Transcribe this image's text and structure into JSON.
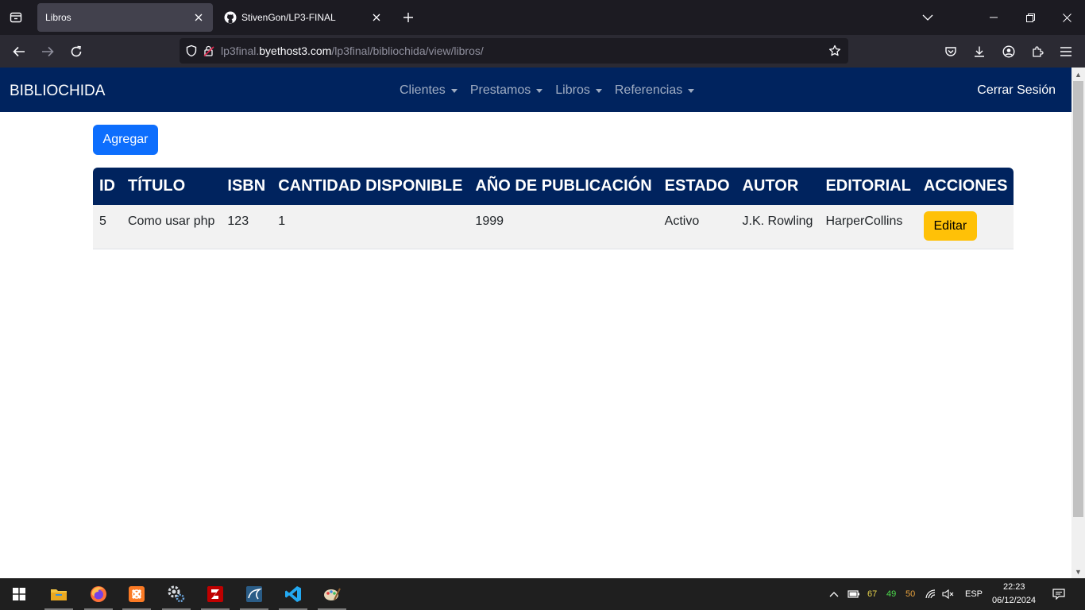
{
  "browser": {
    "tabs": [
      {
        "title": "Libros",
        "active": true
      },
      {
        "title": "StivenGon/LP3-FINAL",
        "active": false
      }
    ],
    "url": {
      "prefix": "lp3final.",
      "domain": "byethost3.com",
      "path": "/lp3final/bibliochida/view/libros/"
    }
  },
  "site": {
    "brand": "BIBLIOCHIDA",
    "menu": [
      "Clientes",
      "Prestamos",
      "Libros",
      "Referencias"
    ],
    "logout": "Cerrar Sesión"
  },
  "main": {
    "add_label": "Agregar",
    "table": {
      "headers": [
        "ID",
        "TÍTULO",
        "ISBN",
        "CANTIDAD DISPONIBLE",
        "AÑO DE PUBLICACIÓN",
        "ESTADO",
        "AUTOR",
        "EDITORIAL",
        "ACCIONES"
      ],
      "rows": [
        {
          "id": "5",
          "titulo": "Como usar php",
          "isbn": "123",
          "cantidad": "1",
          "anio": "1999",
          "estado": "Activo",
          "autor": "J.K. Rowling",
          "editorial": "HarperCollins",
          "action": "Editar"
        }
      ]
    }
  },
  "taskbar": {
    "apps": [
      "windows-start",
      "file-explorer",
      "firefox",
      "xampp",
      "settings-gear",
      "filezilla",
      "mysql-workbench",
      "vscode",
      "paint"
    ],
    "tray": {
      "temp_cpu": "67",
      "temp_gpu": "49",
      "temp_other": "50",
      "language": "ESP",
      "time": "22:23",
      "date": "06/12/2024"
    }
  },
  "colors": {
    "site_nav": "#00235e",
    "primary": "#0d6efd",
    "warning": "#ffc107",
    "browser_tabbar": "#1c1b22",
    "browser_toolbar": "#2b2a33"
  }
}
